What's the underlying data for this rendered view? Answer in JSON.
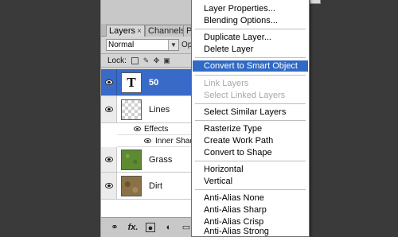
{
  "panel": {
    "tabs": [
      {
        "label": "Layers",
        "close": "×"
      },
      {
        "label": "Channels"
      },
      {
        "label": "P"
      }
    ],
    "blend_mode": "Normal",
    "opacity_label": "Opa",
    "lock_label": "Lock:",
    "layers": [
      {
        "name": "50",
        "thumb": "text",
        "thumb_glyph": "T",
        "selected": true
      },
      {
        "name": "Lines",
        "thumb": "checker",
        "effects_label": "Effects",
        "effect": "Inner Shad"
      },
      {
        "name": "Grass",
        "thumb": "grass"
      },
      {
        "name": "Dirt",
        "thumb": "dirt"
      }
    ],
    "bottom_icons": [
      "link-icon",
      "fx-icon",
      "mask-icon",
      "adjustment-icon",
      "folder-icon"
    ],
    "bottom_fx_label": "fx."
  },
  "menu": {
    "items": [
      {
        "label": "Layer Properties..."
      },
      {
        "label": "Blending Options..."
      },
      {
        "label": "Duplicate Layer..."
      },
      {
        "label": "Delete Layer"
      },
      {
        "label": "Convert to Smart Object",
        "highlighted": true
      },
      {
        "label": "Link Layers",
        "disabled": true
      },
      {
        "label": "Select Linked Layers",
        "disabled": true
      },
      {
        "label": "Select Similar Layers"
      },
      {
        "label": "Rasterize Type"
      },
      {
        "label": "Create Work Path"
      },
      {
        "label": "Convert to Shape"
      },
      {
        "label": "Horizontal"
      },
      {
        "label": "Vertical"
      },
      {
        "label": "Anti-Alias None"
      },
      {
        "label": "Anti-Alias Sharp"
      },
      {
        "label": "Anti-Alias Crisp"
      },
      {
        "label": "Anti-Alias Strong"
      }
    ]
  },
  "colors": {
    "selection": "#3a6ac8",
    "menu_highlight": "#316ac5"
  }
}
